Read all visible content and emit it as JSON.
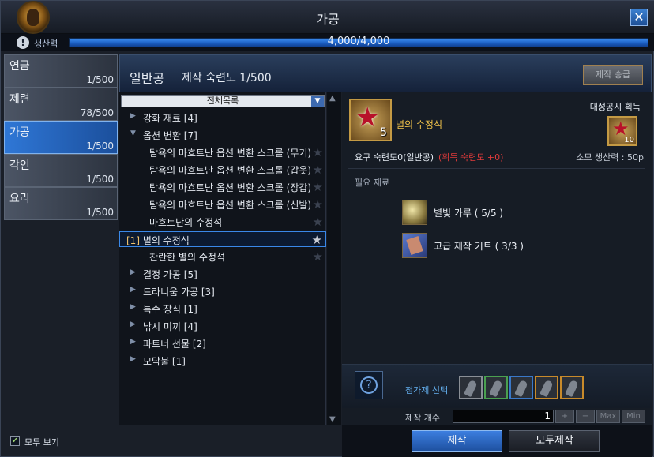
{
  "window": {
    "title": "가공",
    "close_label": "✕"
  },
  "productivity": {
    "label": "생산력",
    "value_text": "4,000/4,000",
    "fill_fraction": 1.0
  },
  "sidebar": {
    "items": [
      {
        "name": "연금",
        "count": "1/500",
        "active": false
      },
      {
        "name": "제련",
        "count": "78/500",
        "active": false
      },
      {
        "name": "가공",
        "count": "1/500",
        "active": true
      },
      {
        "name": "각인",
        "count": "1/500",
        "active": false
      },
      {
        "name": "요리",
        "count": "1/500",
        "active": false
      }
    ],
    "show_all_label": "모두 보기",
    "show_all_checked": true
  },
  "header": {
    "craft_type": "일반공",
    "proficiency": "제작 숙련도 1/500",
    "promote_label": "제작 승급"
  },
  "recipe_list": {
    "category_select": "전체목록",
    "rows": [
      {
        "kind": "category",
        "expanded": false,
        "text": "강화 재료 [4]"
      },
      {
        "kind": "category",
        "expanded": true,
        "text": "옵션 변환 [7]"
      },
      {
        "kind": "child",
        "text": "탐욕의 마흐트난 옵션 변환 스크롤 (무기)"
      },
      {
        "kind": "child",
        "text": "탐욕의 마흐트난 옵션 변환 스크롤 (갑옷)"
      },
      {
        "kind": "child",
        "text": "탐욕의 마흐트난 옵션 변환 스크롤 (장갑)"
      },
      {
        "kind": "child",
        "text": "탐욕의 마흐트난 옵션 변환 스크롤 (신발)"
      },
      {
        "kind": "child",
        "text": "마흐트난의 수정석"
      },
      {
        "kind": "selected",
        "prefix": "[1]",
        "text": "별의 수정석"
      },
      {
        "kind": "child",
        "text": "찬란한 별의 수정석"
      },
      {
        "kind": "category",
        "expanded": false,
        "text": "결정 가공 [5]"
      },
      {
        "kind": "category",
        "expanded": false,
        "text": "드라니움 가공 [3]"
      },
      {
        "kind": "category",
        "expanded": false,
        "text": "특수 장식 [1]"
      },
      {
        "kind": "category",
        "expanded": false,
        "text": "낚시 미끼 [4]"
      },
      {
        "kind": "category",
        "expanded": false,
        "text": "파트너 선물 [2]"
      },
      {
        "kind": "category",
        "expanded": false,
        "text": "모닥불 [1]"
      }
    ]
  },
  "detail": {
    "item_name": "별의 수정석",
    "item_count": "5",
    "great_success_label": "대성공시 획득",
    "great_success_count": "10",
    "required_proficiency": "요구 숙련도0(일반공)",
    "gain_proficiency": "(획득 숙련도 +0)",
    "consume_productivity": "소모 생산력 : 50p",
    "materials_heading": "필요 재료",
    "materials": [
      {
        "name": "별빛 가루 ( 5/5 )",
        "icon": "star-dust-icon"
      },
      {
        "name": "고급 제작 키트 ( 3/3 )",
        "icon": "crafting-kit-icon"
      }
    ],
    "help_label": "?",
    "catalyst_label": "첨가제 선택",
    "catalyst_slots": [
      "gray",
      "green",
      "blue",
      "gold",
      "gold"
    ],
    "quantity_label": "제작 개수",
    "quantity_value": "1",
    "qty_buttons": {
      "plus": "+",
      "minus": "−",
      "max": "Max",
      "min": "Min"
    }
  },
  "buttons": {
    "craft": "제작",
    "craft_all": "모두제작"
  },
  "colors": {
    "accent_blue": "#2f77d6",
    "item_name_gold": "#f0c24a",
    "bonus_red": "#e03a3a",
    "catalyst_label": "#64b0f0"
  }
}
